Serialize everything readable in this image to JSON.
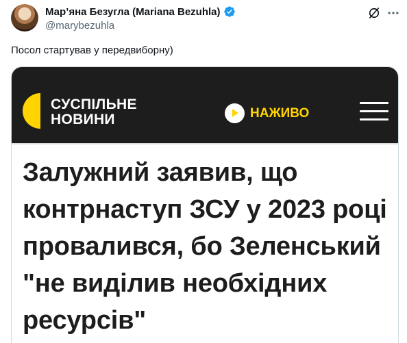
{
  "tweet": {
    "display_name": "Мар’яна Безугла (Mariana Bezuhla)",
    "handle": "@marybezuhla",
    "text": "Посол стартував у передвиборну)"
  },
  "article": {
    "brand_line1": "СУСПІЛЬНЕ",
    "brand_line2": "НОВИНИ",
    "live_label": "НАЖИВО",
    "headline": "Залужний заявив, що контрнаступ ЗСУ у 2023 році провалився, бо Зеленський \"не виділив необхідних ресурсів\""
  },
  "colors": {
    "verified": "#1d9bf0",
    "brand_yellow": "#ffd400",
    "header_bg": "#1d1d1d"
  },
  "icons": [
    "verified-badge-icon",
    "grok-icon",
    "more-options-icon",
    "play-icon",
    "hamburger-menu-icon"
  ]
}
